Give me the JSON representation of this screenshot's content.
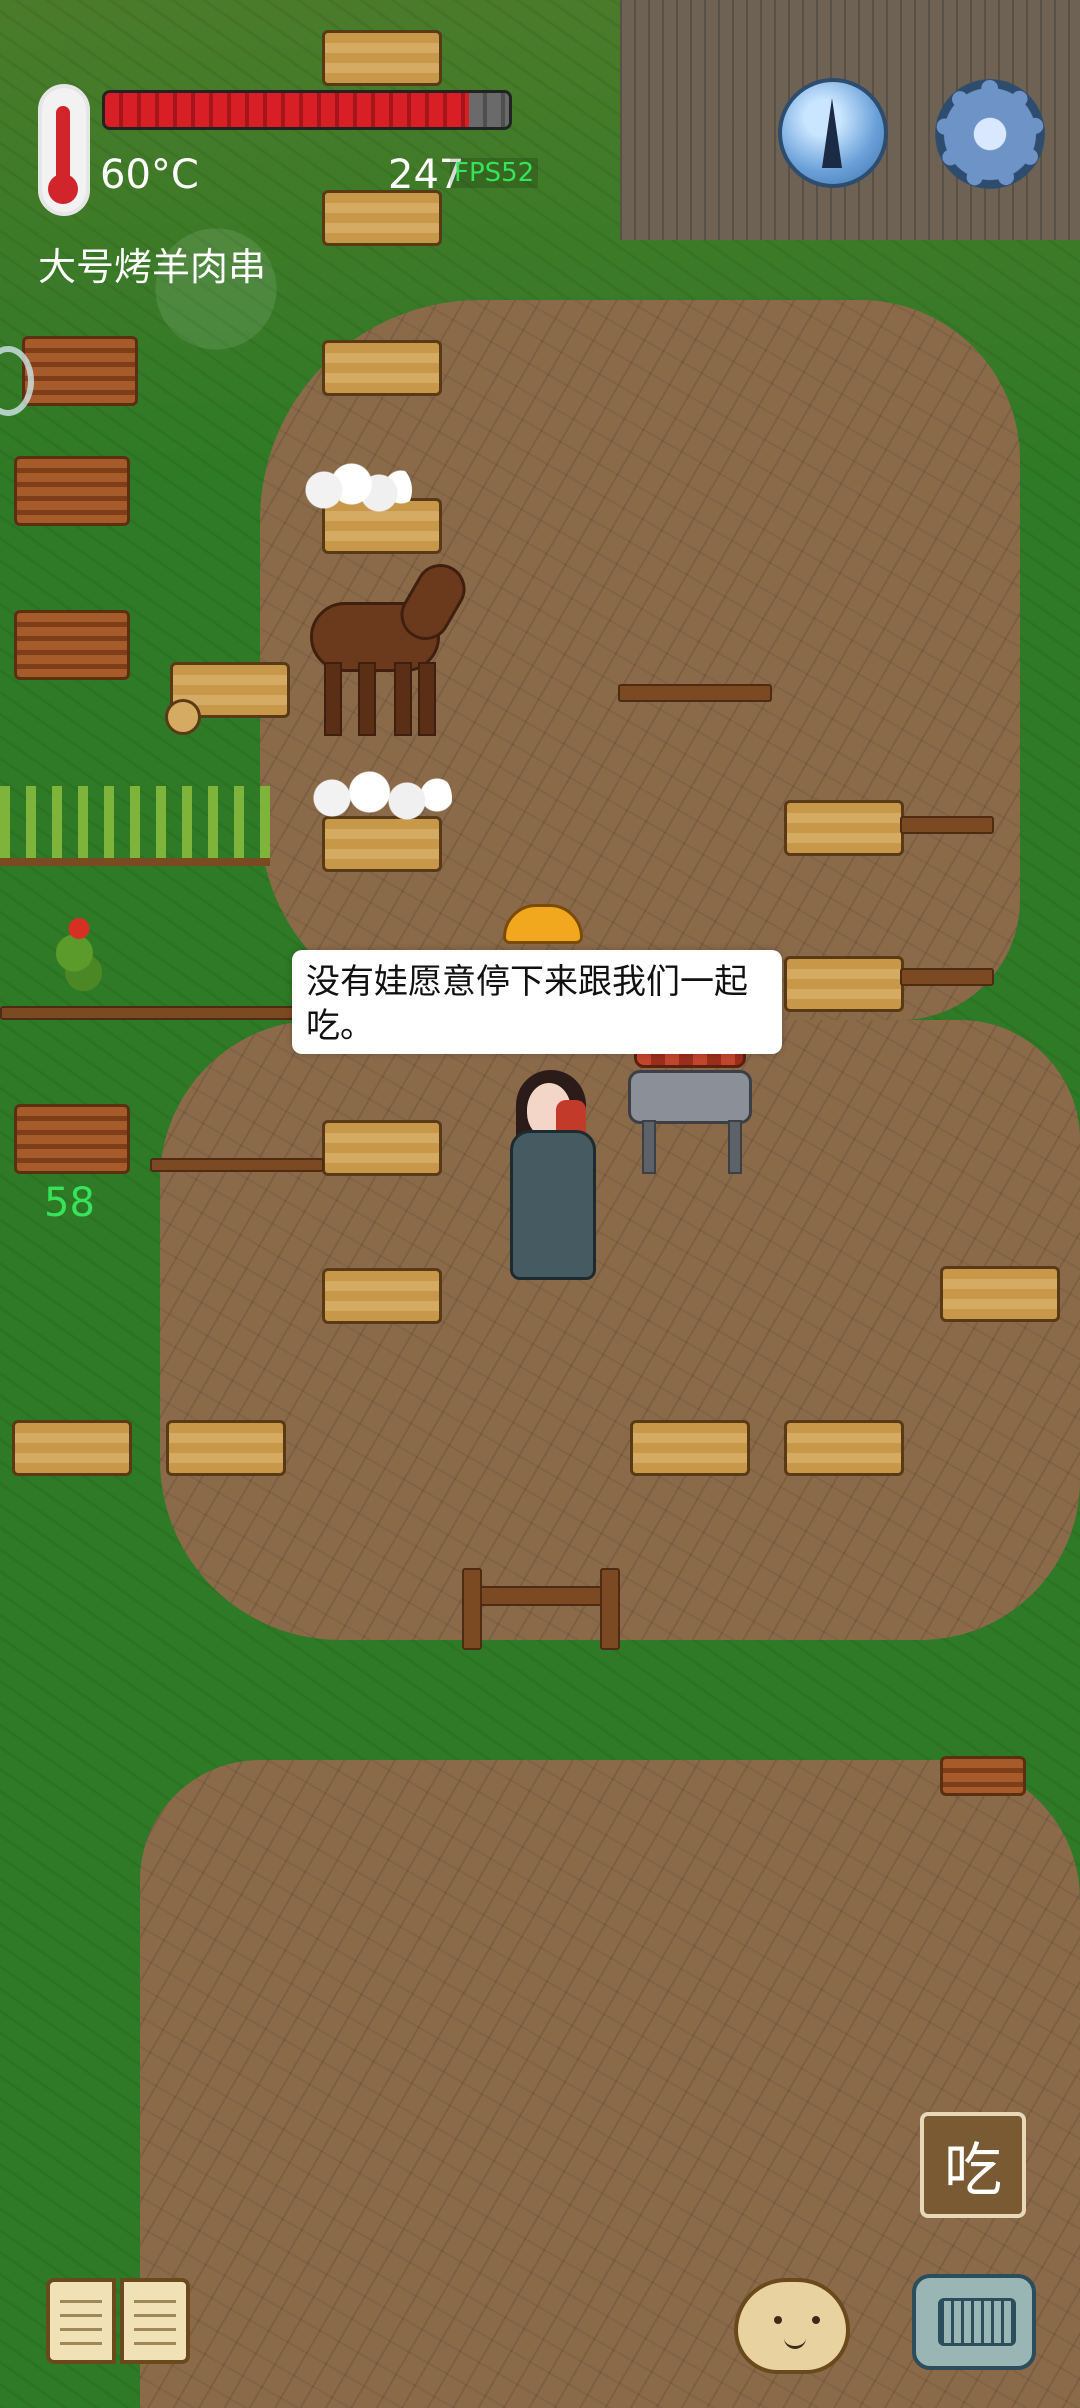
{
  "hud": {
    "temperature": "60°C",
    "held_item": "大号烤羊肉串",
    "score_number": "247",
    "fps": "FPS52",
    "health_fraction": 0.9
  },
  "world": {
    "speech_text": "没有娃愿意停下来跟我们一起吃。",
    "left_counter": "58"
  },
  "buttons": {
    "eat_label": "吃"
  },
  "icons": {
    "thermometer": "thermometer-icon",
    "compass": "compass-icon",
    "settings": "gear-icon",
    "book": "book-icon",
    "emote": "face-icon",
    "keyboard": "keyboard-icon"
  }
}
